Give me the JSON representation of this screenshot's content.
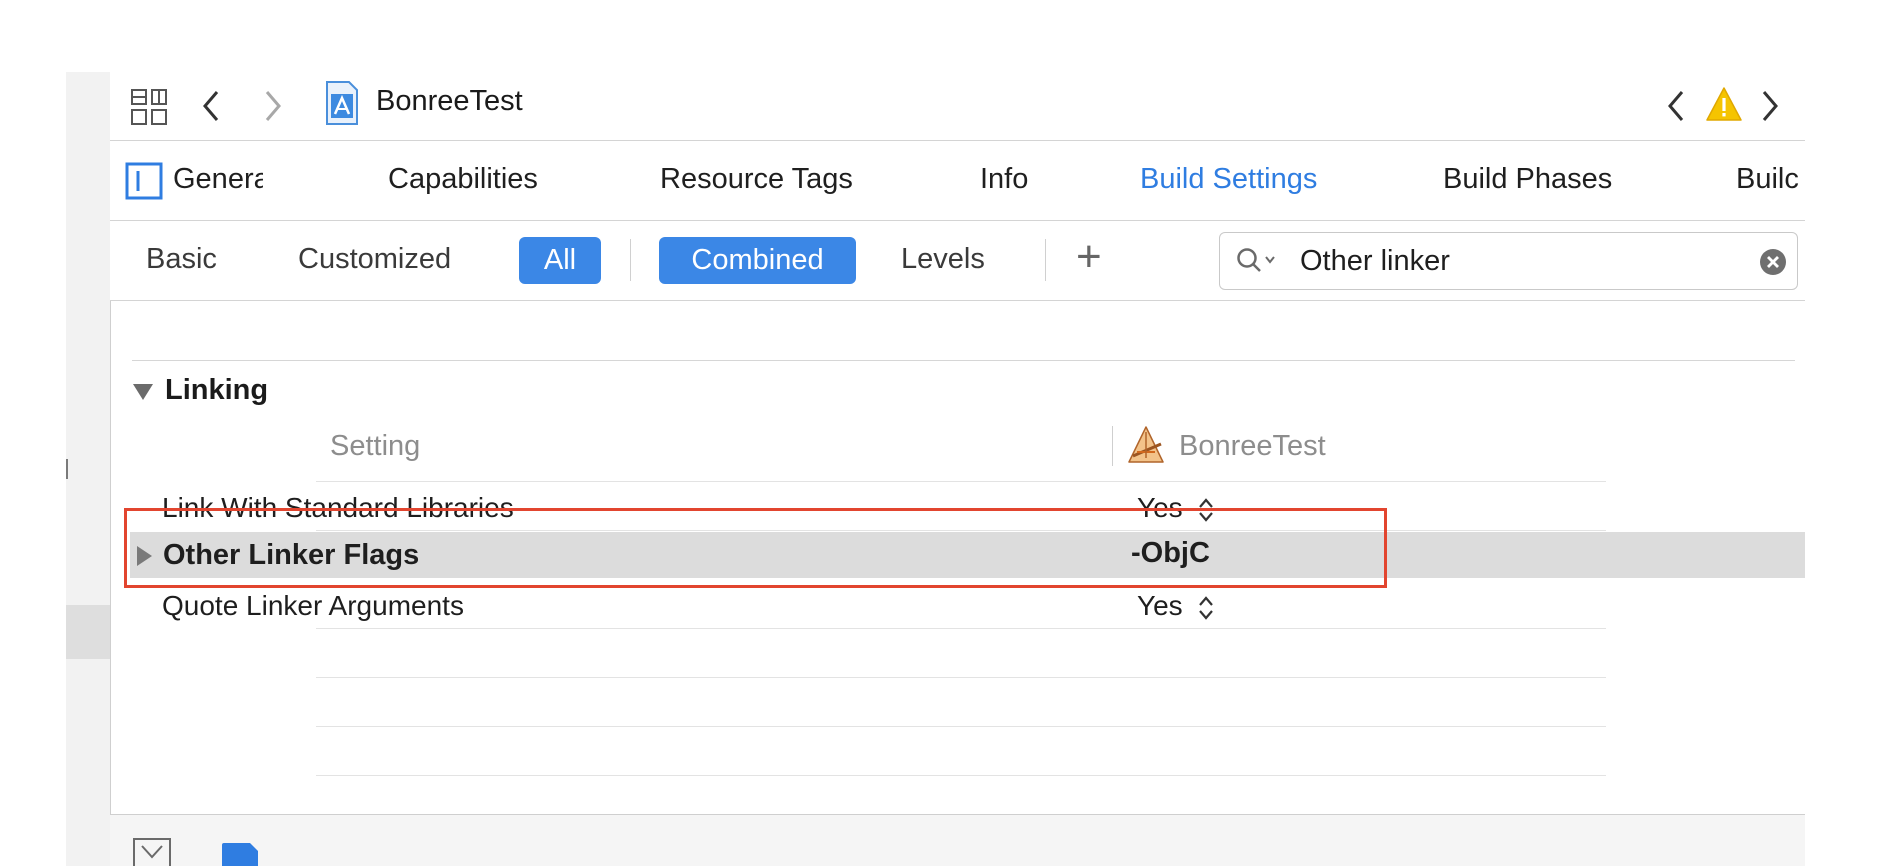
{
  "jump_bar": {
    "project_name": "BonreeTest",
    "issue_icon_color": "#f5c400"
  },
  "tabs": [
    {
      "label": "General"
    },
    {
      "label": "Capabilities"
    },
    {
      "label": "Resource Tags"
    },
    {
      "label": "Info"
    },
    {
      "label": "Build Settings",
      "active": true
    },
    {
      "label": "Build Phases"
    },
    {
      "label": "Builc"
    }
  ],
  "filter_bar": {
    "basic": "Basic",
    "customized": "Customized",
    "all": "All",
    "combined": "Combined",
    "levels": "Levels",
    "add": "+",
    "search_value": "Other linker",
    "accent_color": "#3b87e6"
  },
  "section": {
    "title": "Linking",
    "column_setting": "Setting",
    "column_target": "BonreeTest",
    "rows": [
      {
        "label": "Link With Standard Libraries",
        "value": "Yes"
      },
      {
        "label": "Other Linker Flags",
        "value": "-ObjC",
        "selected": true
      },
      {
        "label": "Quote Linker Arguments",
        "value": "Yes"
      }
    ]
  },
  "highlight_color": "#e2452f"
}
